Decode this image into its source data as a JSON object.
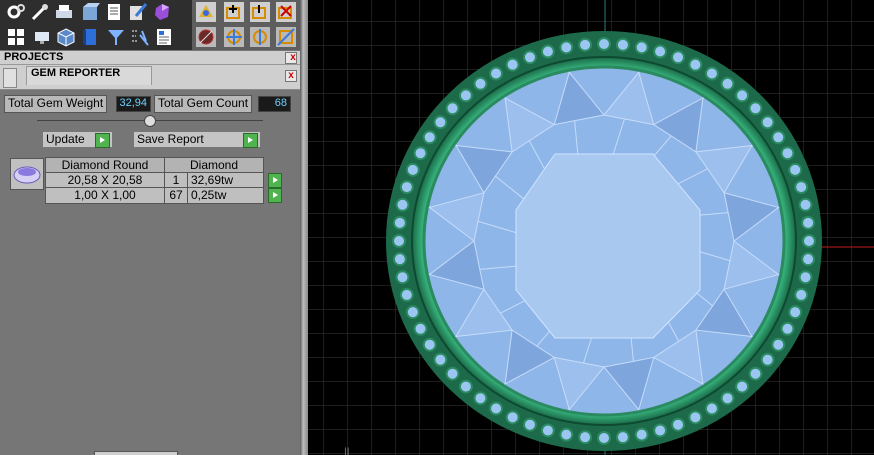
{
  "panel": {
    "projects_title": "PROJECTS",
    "gem_reporter_title": "GEM REPORTER",
    "close_glyph": "x",
    "total_weight_label": "Total Gem Weight",
    "total_weight_value": "32,94",
    "total_count_label": "Total Gem Count",
    "total_count_value": "68",
    "update_label": "Update",
    "save_report_label": "Save Report"
  },
  "report": {
    "headers": [
      "Diamond Round",
      "Diamond"
    ],
    "rows": [
      {
        "size": "20,58 X 20,58",
        "count": "1",
        "weight": "32,69tw"
      },
      {
        "size": "1,00 X 1,00",
        "count": "67",
        "weight": "0,25tw"
      }
    ]
  },
  "toolbar": {
    "row1_icons": [
      "settings-icon",
      "tools-icon",
      "printer-icon",
      "box-icon",
      "document-icon",
      "brush-icon",
      "gem-icon",
      "render-icon",
      "layer-icon",
      "move-icon",
      "delete-icon"
    ],
    "row2_icons": [
      "layout-icon",
      "monitor-icon",
      "cube-icon",
      "book-icon",
      "filter-icon",
      "select-icon",
      "report-icon",
      "sphere-icon",
      "transform-icon",
      "align-icon",
      "scale-icon"
    ]
  },
  "colors": {
    "panel_bg": "#767676",
    "viewport_bg": "#000000",
    "grid": "#3a3a3a",
    "gem": "#8fb6e8",
    "metal": "#2e9a6a",
    "axis_red": "#c01c1c",
    "value_text": "#6fd0ff"
  }
}
